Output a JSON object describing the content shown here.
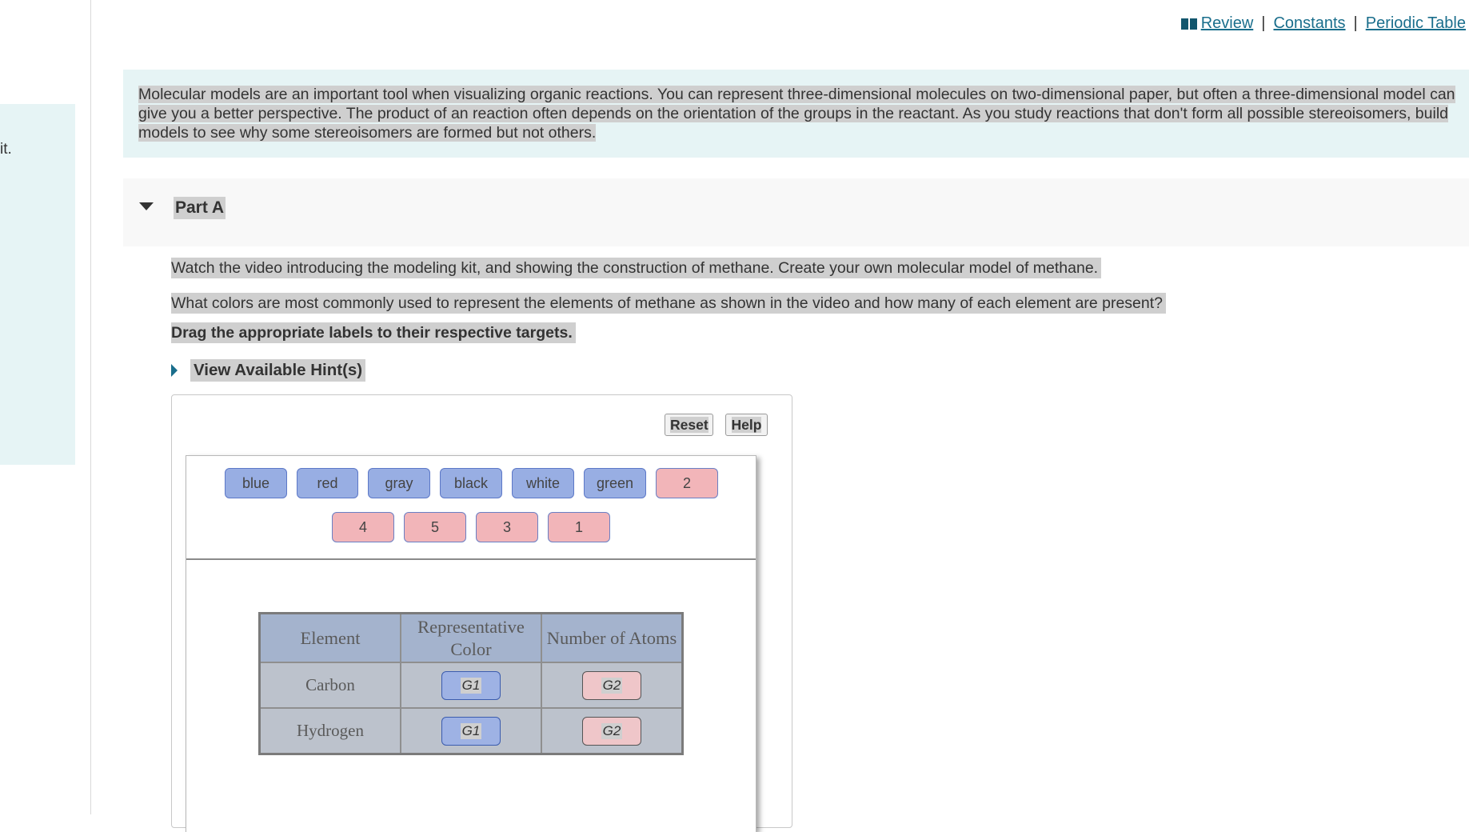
{
  "left_panel": {
    "text": "it."
  },
  "toplinks": {
    "review": "Review",
    "sep1": "|",
    "constants": "Constants",
    "sep2": "|",
    "periodic_table": "Periodic Table"
  },
  "intro": {
    "text": "Molecular models are an important tool when visualizing organic reactions. You can represent three-dimensional molecules on two-dimensional paper, but often a three-dimensional model can give you a better perspective. The product of an reaction often depends on the orientation of the groups in the reactant. As you study reactions that don't form all possible stereoisomers, build models to see why some stereoisomers are formed but not others."
  },
  "part": {
    "title": "Part A",
    "q1": "Watch the video introducing the modeling kit, and showing the construction of methane. Create your own molecular model of methane.",
    "q2": "What colors are most commonly used to represent the elements of methane as shown in the video and how many of each element are present?",
    "instruction": "Drag the appropriate labels to their respective targets.",
    "hint": "View Available Hint(s)"
  },
  "widget": {
    "reset": "Reset",
    "help": "Help",
    "color_labels": [
      "blue",
      "red",
      "gray",
      "black",
      "white",
      "green"
    ],
    "number_labels_row1": [
      "2"
    ],
    "number_labels_row2": [
      "4",
      "5",
      "3",
      "1"
    ],
    "table": {
      "headers": [
        "Element",
        "Representative Color",
        "Number of Atoms"
      ],
      "rows": [
        {
          "element": "Carbon",
          "color_target": "G1",
          "count_target": "G2"
        },
        {
          "element": "Hydrogen",
          "color_target": "G1",
          "count_target": "G2"
        }
      ]
    }
  },
  "colors": {
    "accent_link": "#1a6e8c",
    "panel_bg": "#e6f4f5",
    "color_chip": "#98aee3",
    "number_chip": "#f2b5b9"
  }
}
